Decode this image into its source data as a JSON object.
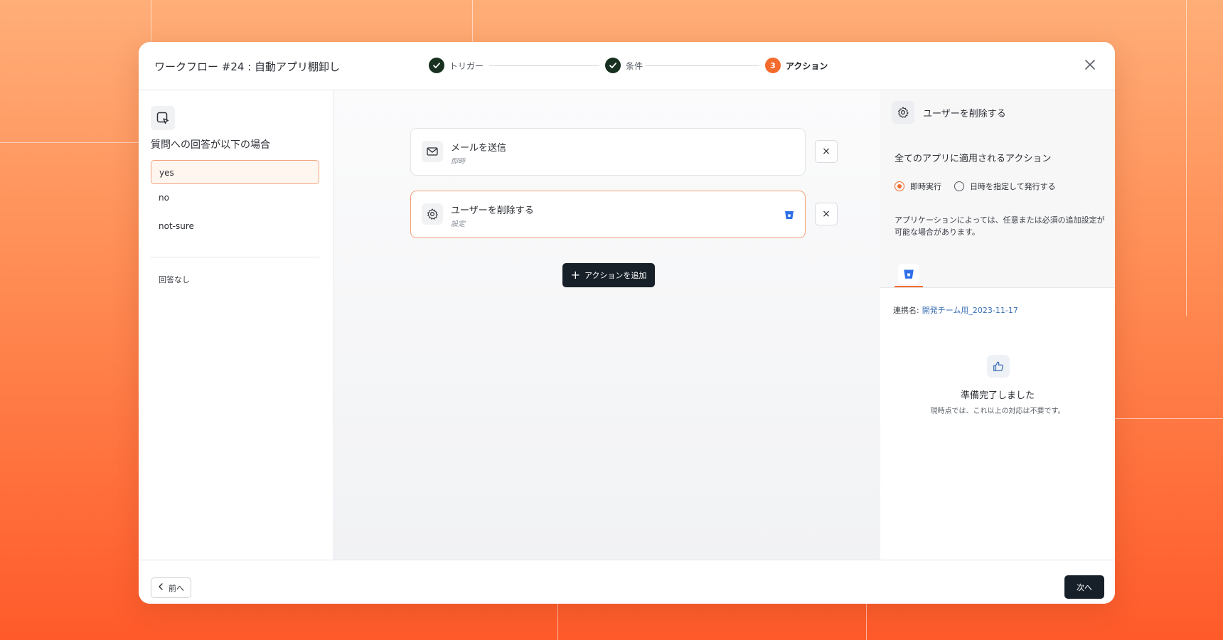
{
  "colors": {
    "accent": "#f46b2d",
    "dark_button": "#172029",
    "check": "#17301f",
    "link": "#3a6fb5",
    "app_blue": "#2f6fe8"
  },
  "header": {
    "title": "ワークフロー #24 : 自動アプリ棚卸し",
    "steps": [
      {
        "label": "トリガー",
        "state": "done",
        "icon": "check-icon"
      },
      {
        "label": "条件",
        "state": "done",
        "icon": "check-icon"
      },
      {
        "label": "アクション",
        "state": "active",
        "number": "3"
      }
    ],
    "close_icon": "close-icon"
  },
  "left_panel": {
    "icon": "cursor-box-icon",
    "heading": "質問への回答が以下の場合",
    "answers": [
      {
        "label": "yes",
        "selected": true
      },
      {
        "label": "no",
        "selected": false
      },
      {
        "label": "not-sure",
        "selected": false
      }
    ],
    "no_answer": "回答なし"
  },
  "center": {
    "actions": [
      {
        "title": "メールを送信",
        "sub": "即時",
        "icon": "mail-icon",
        "selected": false
      },
      {
        "title": "ユーザーを削除する",
        "sub": "設定",
        "icon": "gear-icon",
        "selected": true,
        "app_icon": "bucket-app-icon"
      }
    ],
    "remove_icon": "×",
    "add_label": "アクションを追加"
  },
  "right_panel": {
    "title": "ユーザーを削除する",
    "subheading": "全てのアプリに適用されるアクション",
    "radio_options": [
      {
        "label": "即時実行",
        "selected": true
      },
      {
        "label": "日時を指定して発行する",
        "selected": false
      }
    ],
    "note": "アプリケーションによっては、任意または必須の追加設定が可能な場合があります。",
    "connection_label": "連携名:",
    "connection_value": "開発チーム用_2023-11-17",
    "ready_title": "準備完了しました",
    "ready_sub": "現時点では、これ以上の対応は不要です。"
  },
  "footer": {
    "prev_label": "前へ",
    "next_label": "次へ"
  }
}
